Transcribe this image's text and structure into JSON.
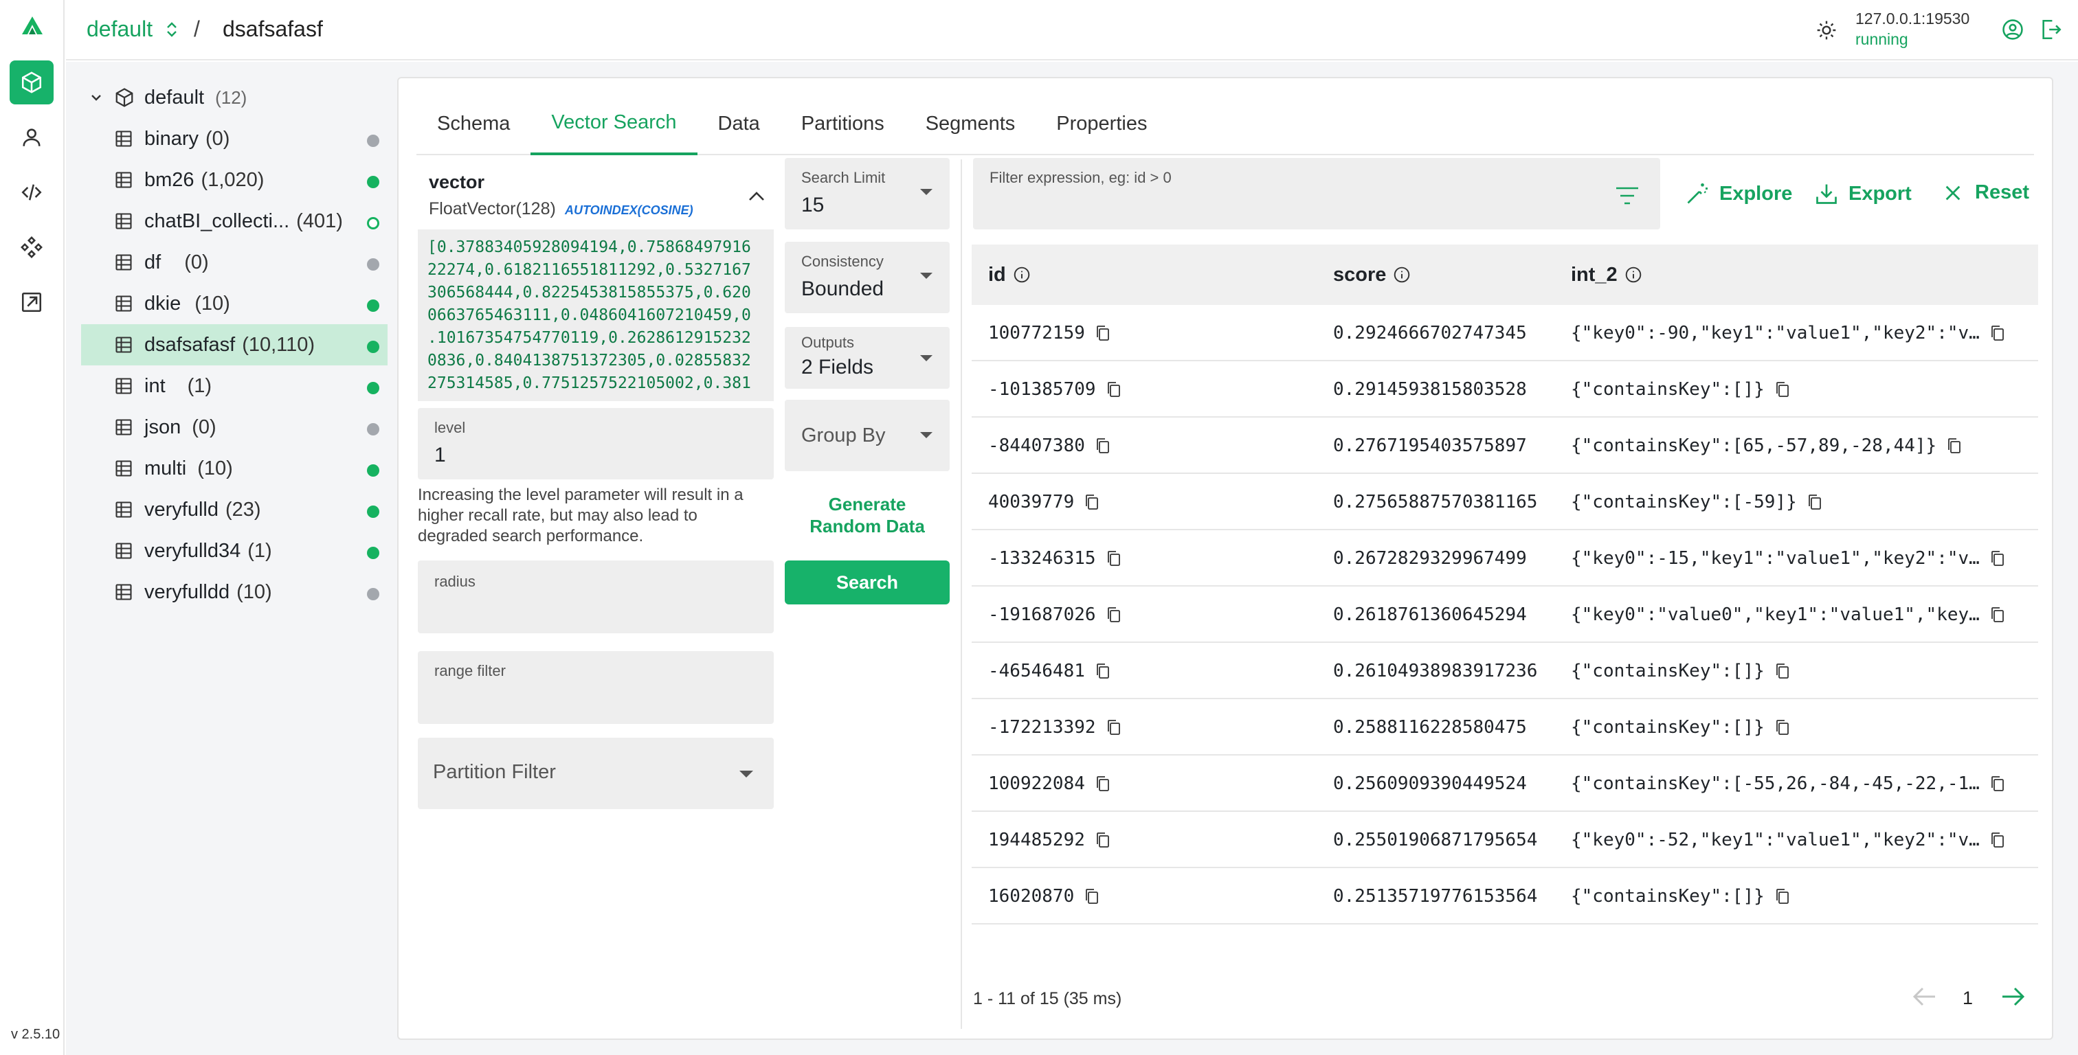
{
  "app": {
    "version": "v 2.5.10",
    "server_address": "127.0.0.1:19530",
    "server_status": "running",
    "accent": "#16a35f"
  },
  "header": {
    "database": "default",
    "separator": "/",
    "collection": "dsafsafasf"
  },
  "tree": {
    "root": {
      "label": "default",
      "count": "(12)"
    },
    "items": [
      {
        "name": "binary",
        "count": "(0)",
        "status": "gray"
      },
      {
        "name": "bm26",
        "count": "(1,020)",
        "status": "green"
      },
      {
        "name": "chatBI_collecti...",
        "count": "(401)",
        "status": "ring"
      },
      {
        "name": "df",
        "count": "(0)",
        "status": "gray"
      },
      {
        "name": "dkie",
        "count": "(10)",
        "status": "green"
      },
      {
        "name": "dsafsafasf",
        "count": "(10,110)",
        "status": "green"
      },
      {
        "name": "int",
        "count": "(1)",
        "status": "green"
      },
      {
        "name": "json",
        "count": "(0)",
        "status": "gray"
      },
      {
        "name": "multi",
        "count": "(10)",
        "status": "green"
      },
      {
        "name": "veryfulld",
        "count": "(23)",
        "status": "green"
      },
      {
        "name": "veryfulld34",
        "count": "(1)",
        "status": "green"
      },
      {
        "name": "veryfulldd",
        "count": "(10)",
        "status": "gray"
      }
    ]
  },
  "tabs": [
    "Schema",
    "Vector Search",
    "Data",
    "Partitions",
    "Segments",
    "Properties"
  ],
  "vector": {
    "field": "vector",
    "type": "FloatVector(128)",
    "index": "AUTOINDEX(COSINE)",
    "value_lines": [
      "[0.37883405928094194,0.75868497916",
      "22274,0.6182116551811292,0.5327167",
      "306568444,0.8225453815855375,0.620",
      "0663765463111,0.0486041607210459,0",
      ".10167354754770119,0.2628612915232",
      "0836,0.8404138751372305,0.02855832",
      "275314585,0.7751257522105002,0.381"
    ]
  },
  "level": {
    "label": "level",
    "value": "1",
    "help": [
      "Increasing the level parameter will result in a",
      "higher recall rate, but may also lead to",
      "degraded search performance."
    ]
  },
  "radius": {
    "label": "radius"
  },
  "range_filter": {
    "label": "range filter"
  },
  "partition_filter": {
    "label": "Partition Filter"
  },
  "search_limit": {
    "label": "Search Limit",
    "value": "15"
  },
  "consistency": {
    "label": "Consistency",
    "value": "Bounded"
  },
  "outputs": {
    "label": "Outputs",
    "value": "2 Fields"
  },
  "group_by": {
    "label": "Group By"
  },
  "generate": {
    "line1": "Generate",
    "line2": "Random Data"
  },
  "search_button": "Search",
  "filter": {
    "placeholder": "Filter expression, eg: id > 0"
  },
  "actions": {
    "explore": "Explore",
    "export": "Export",
    "reset": "Reset"
  },
  "table": {
    "columns": [
      "id",
      "score",
      "int_2"
    ],
    "rows": [
      {
        "id": "100772159",
        "score": "0.2924666702747345",
        "int_2": "{\"key0\":-90,\"key1\":\"value1\",\"key2\":\"v…"
      },
      {
        "id": "-101385709",
        "score": "0.2914593815803528",
        "int_2": "{\"containsKey\":[]}"
      },
      {
        "id": "-84407380",
        "score": "0.2767195403575897",
        "int_2": "{\"containsKey\":[65,-57,89,-28,44]}"
      },
      {
        "id": "40039779",
        "score": "0.27565887570381165",
        "int_2": "{\"containsKey\":[-59]}"
      },
      {
        "id": "-133246315",
        "score": "0.2672829329967499",
        "int_2": "{\"key0\":-15,\"key1\":\"value1\",\"key2\":\"v…"
      },
      {
        "id": "-191687026",
        "score": "0.2618761360645294",
        "int_2": "{\"key0\":\"value0\",\"key1\":\"value1\",\"key…"
      },
      {
        "id": "-46546481",
        "score": "0.26104938983917236",
        "int_2": "{\"containsKey\":[]}"
      },
      {
        "id": "-172213392",
        "score": "0.2588116228580475",
        "int_2": "{\"containsKey\":[]}"
      },
      {
        "id": "100922084",
        "score": "0.2560909390449524",
        "int_2": "{\"containsKey\":[-55,26,-84,-45,-22,-1…"
      },
      {
        "id": "194485292",
        "score": "0.25501906871795654",
        "int_2": "{\"key0\":-52,\"key1\":\"value1\",\"key2\":\"v…"
      },
      {
        "id": "16020870",
        "score": "0.25135719776153564",
        "int_2": "{\"containsKey\":[]}"
      }
    ]
  },
  "pagination": {
    "summary": "1 - 11 of 15 (35 ms)",
    "page": "1"
  }
}
